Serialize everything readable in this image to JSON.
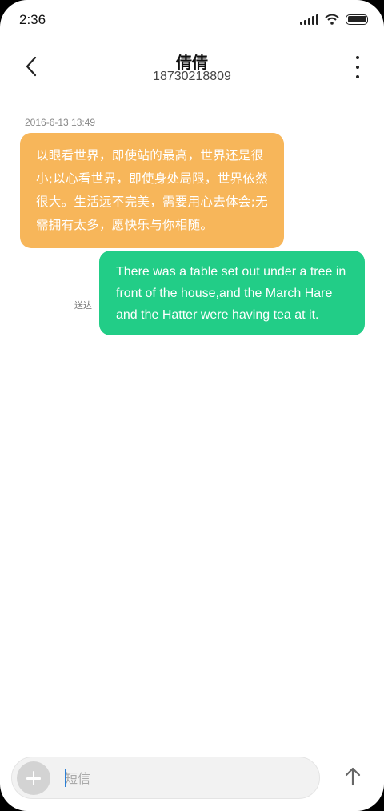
{
  "status_bar": {
    "time": "2:36"
  },
  "header": {
    "contact_name": "倩倩",
    "phone_number": "18730218809"
  },
  "messages": [
    {
      "direction": "incoming",
      "timestamp": "2016-6-13 13:49",
      "text": "以眼看世界，即使站的最高，世界还是很小;以心看世界，即使身处局限，世界依然很大。生活远不完美，需要用心去体会;无需拥有太多，愿快乐与你相随。",
      "color": "#f7b65a"
    },
    {
      "direction": "outgoing",
      "status": "送达",
      "text": "There was a table set out under a tree in front of the house,and the March Hare and the Hatter were having tea at it.",
      "color": "#22cd87"
    }
  ],
  "composer": {
    "placeholder": "短信"
  },
  "icons": {
    "back": "back-arrow-icon",
    "more": "more-vertical-icon",
    "add": "plus-icon",
    "send": "send-arrow-up-icon"
  }
}
